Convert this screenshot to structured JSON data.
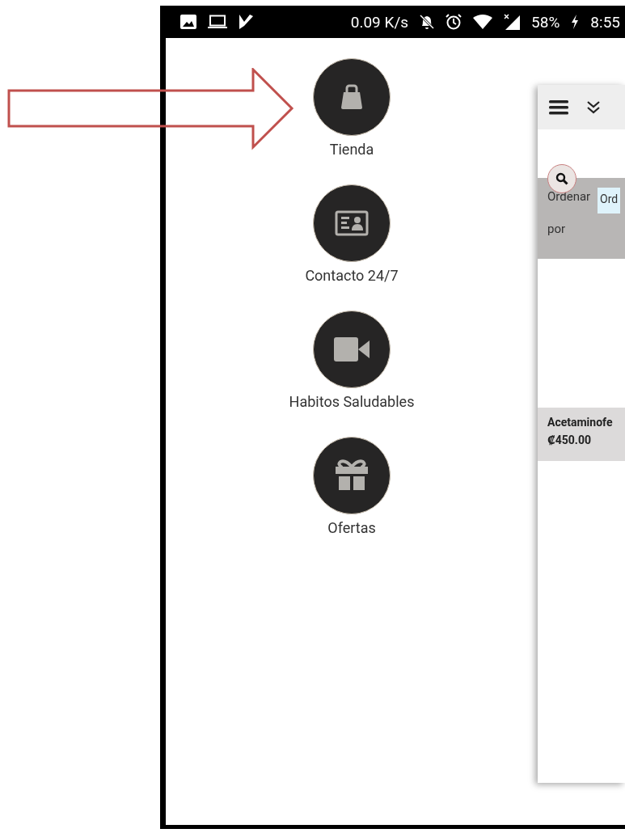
{
  "status_bar": {
    "speed": "0.09 K/s",
    "battery": "58%",
    "time": "8:55"
  },
  "menu": {
    "items": [
      {
        "label": "Tienda"
      },
      {
        "label": "Contacto 24/7"
      },
      {
        "label": "Habitos Saludables"
      },
      {
        "label": "Ofertas"
      }
    ]
  },
  "panel": {
    "sort_label": "Ordenar por",
    "sort_value": "Ord",
    "product": {
      "name": "Acetaminofe",
      "price": "₡450.00"
    }
  }
}
